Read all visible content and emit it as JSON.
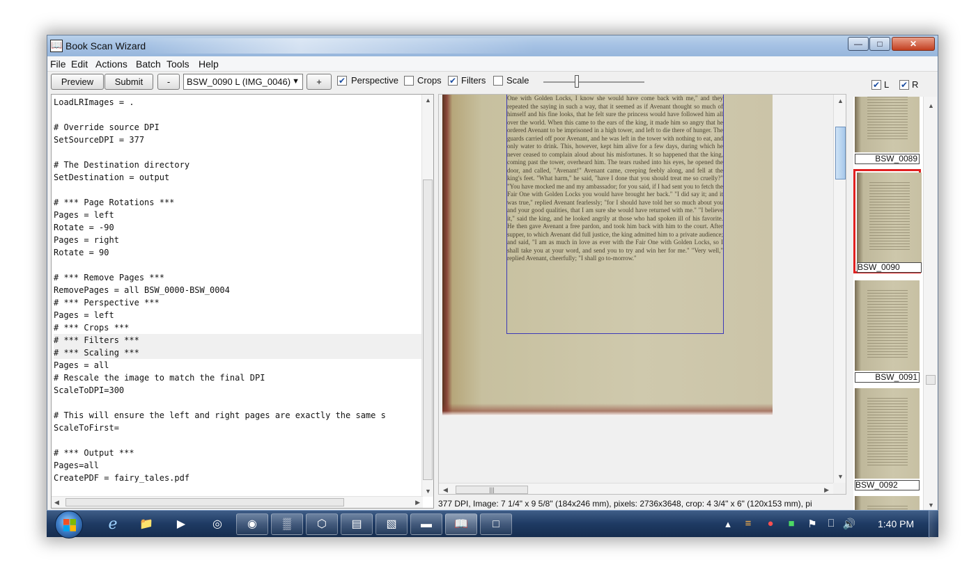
{
  "window": {
    "title": "Book Scan Wizard"
  },
  "menu": [
    "File",
    "Edit",
    "Actions",
    "Batch",
    "Tools",
    "Help"
  ],
  "toolbar": {
    "preview": "Preview",
    "submit": "Submit",
    "minus": "-",
    "plus": "+",
    "combo_value": "BSW_0090 L (IMG_0046)",
    "checks": [
      {
        "label": "Perspective",
        "checked": true
      },
      {
        "label": "Crops",
        "checked": false
      },
      {
        "label": "Filters",
        "checked": true
      },
      {
        "label": "Scale",
        "checked": false
      }
    ]
  },
  "side_checks": [
    {
      "label": "L",
      "checked": true
    },
    {
      "label": "R",
      "checked": true
    }
  ],
  "script_lines": [
    "LoadLRImages = .",
    "",
    "# Override source DPI",
    "SetSourceDPI = 377",
    "",
    "# The Destination directory",
    "SetDestination = output",
    "",
    "# *** Page Rotations ***",
    "Pages = left",
    "Rotate = -90",
    "Pages = right",
    "Rotate = 90",
    "",
    "# *** Remove Pages ***",
    "RemovePages = all BSW_0000-BSW_0004",
    "# *** Perspective ***",
    "Pages = left",
    "# *** Crops ***",
    "# *** Filters ***",
    "# *** Scaling ***",
    "Pages = all",
    "# Rescale the image to match the final DPI",
    "ScaleToDPI=300",
    "",
    "# This will ensure the left and right pages are exactly the same s",
    "ScaleToFirst=",
    "",
    "# *** Output ***",
    "Pages=all",
    "CreatePDF = fairy_tales.pdf"
  ],
  "selected_lines": [
    19,
    20
  ],
  "page_text": "One with Golden Locks, I know she would have come back with me,\" and they repeated the saying in such a way, that it seemed as if Avenant thought so much of himself and his fine looks, that he felt sure the princess would have followed him all over the world. When this came to the ears of the king, it made him so angry that he ordered Avenant to be imprisoned in a high tower, and left to die there of hunger. The guards carried off poor Avenant, and he was left in the tower with nothing to eat, and only water to drink. This, however, kept him alive for a few days, during which he never ceased to complain aloud about his misfortunes. It so happened that the king, coming past the tower, overheard him. The tears rushed into his eyes, he opened the door, and called, \"Avenant!\" Avenant came, creeping feebly along, and fell at the king's feet. \"What harm,\" he said, \"have I done that you should treat me so cruelly?\" \"You have mocked me and my ambassador; for you said, if I had sent you to fetch the Fair One with Golden Locks you would have brought her back.\" \"I did say it; and it was true,\" replied Avenant fearlessly; \"for I should have told her so much about you and your good qualities, that I am sure she would have returned with me.\" \"I believe it,\" said the king, and he looked angrily at those who had spoken ill of his favorite. He then gave Avenant a free pardon, and took him back with him to the court. After supper, to which Avenant did full justice, the king admitted him to a private audience; and said, \"I am as much in love as ever with the Fair One with Golden Locks, so I shall take you at your word, and send you to try and win her for me.\" \"Very well,\" replied Avenant, cheerfully; \"I shall go to-morrow.\"",
  "thumbnails": [
    {
      "label": "BSW_0089",
      "selected": false
    },
    {
      "label": "BSW_0090",
      "selected": true
    },
    {
      "label": "BSW_0091",
      "selected": false
    },
    {
      "label": "BSW_0092",
      "selected": false
    }
  ],
  "status": "377 DPI, Image: 7 1/4\" x 9 5/8\" (184x246 mm), pixels: 2736x3648, crop: 4 3/4\" x 6\" (120x153 mm), pi",
  "taskbar": {
    "clock": "1:40 PM"
  }
}
